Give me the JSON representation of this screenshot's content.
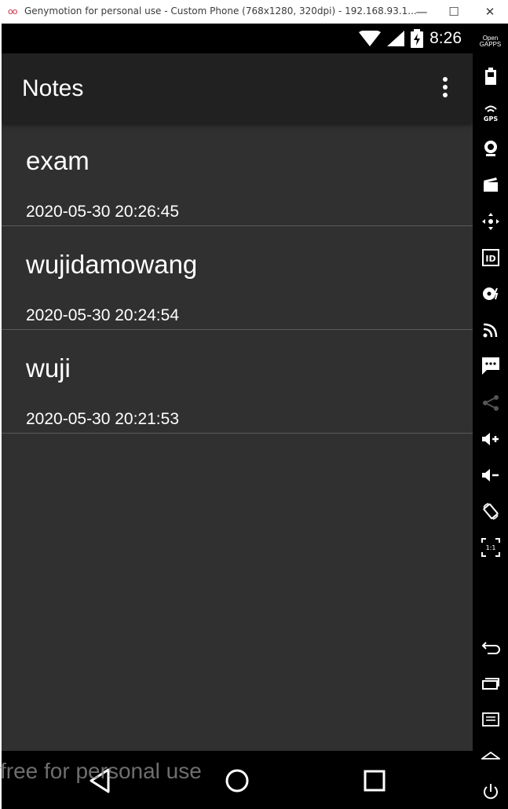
{
  "window": {
    "title": "Genymotion for personal use - Custom Phone (768x1280, 320dpi) - 192.168.93.1...",
    "logo": "oo",
    "minimize": "—",
    "maximize": "☐",
    "close": "✕"
  },
  "statusbar": {
    "time": "8:26"
  },
  "appbar": {
    "title": "Notes"
  },
  "notes": [
    {
      "title": "exam",
      "date": "2020-05-30 20:26:45"
    },
    {
      "title": "wujidamowang",
      "date": "2020-05-30 20:24:54"
    },
    {
      "title": "wuji",
      "date": "2020-05-30 20:21:53"
    }
  ],
  "watermark": "free for personal use",
  "sidebar": {
    "gapps_line1": "Open",
    "gapps_line2": "GAPPS",
    "gps_label": "GPS",
    "id_label": "ID",
    "pixel_label": "1:1"
  }
}
